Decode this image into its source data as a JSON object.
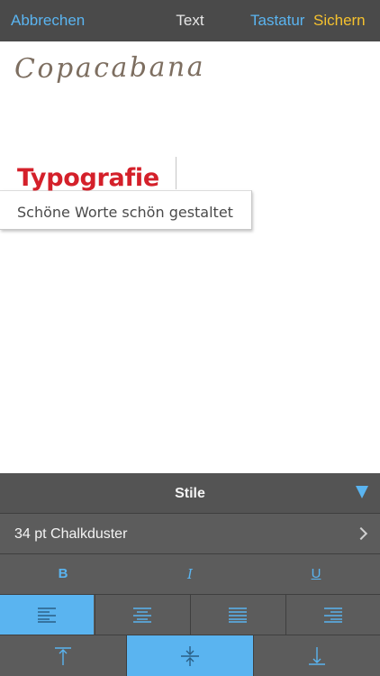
{
  "nav": {
    "cancel_label": "Abbrechen",
    "title": "Text",
    "keyboard_label": "Tastatur",
    "save_label": "Sichern"
  },
  "canvas": {
    "handwriting_text": "Copacabana",
    "typo_title": "Typografie",
    "typo_subtitle": "Schöne Worte schön gestaltet"
  },
  "panel": {
    "title": "Stile",
    "font_label": "34 pt Chalkduster",
    "bold_label": "B",
    "italic_label": "I",
    "underline_label": "U",
    "alignment_selected": "left",
    "vertical_alignment_selected": "center"
  },
  "colors": {
    "accent": "#5ab4f0",
    "save": "#f5c12e",
    "title_red": "#d4202a",
    "bar_bg": "#4a4a4a",
    "panel_bg": "#5c5c5c"
  },
  "icons": {
    "collapse": "triangle-down-icon",
    "disclosure": "chevron-right-icon",
    "align_left": "align-left-icon",
    "align_center": "align-center-icon",
    "align_justify": "align-justify-icon",
    "align_right": "align-right-icon",
    "valign_top": "align-top-icon",
    "valign_center": "align-middle-icon",
    "valign_bottom": "align-bottom-icon"
  }
}
